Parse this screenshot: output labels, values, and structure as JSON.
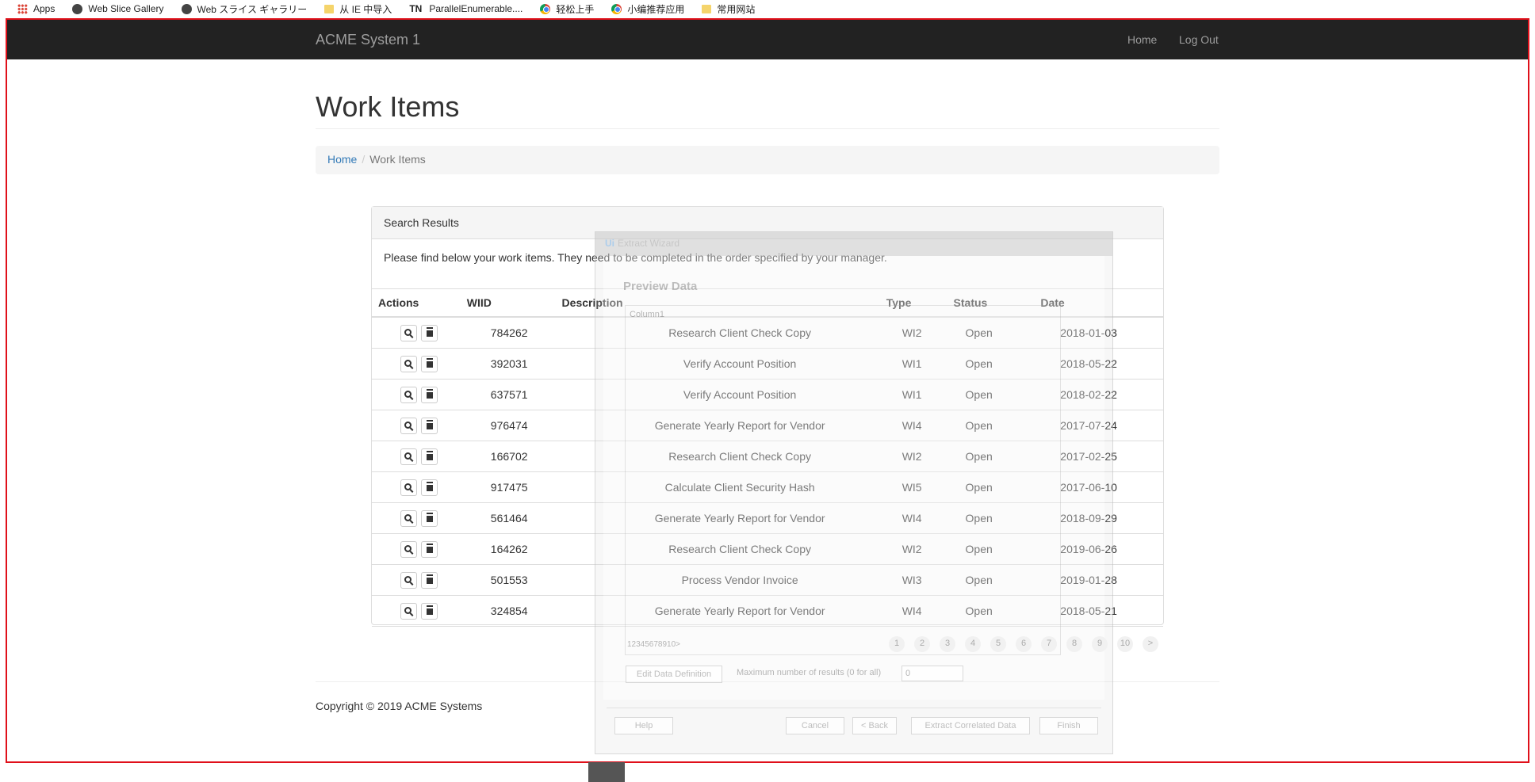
{
  "bookmarks": [
    {
      "label": "Apps",
      "icon": "apps-icon"
    },
    {
      "label": "Web Slice Gallery",
      "icon": "globe-icon"
    },
    {
      "label": "Web スライス ギャラリー",
      "icon": "globe-icon"
    },
    {
      "label": "从 IE 中导入",
      "icon": "folder-icon"
    },
    {
      "label": "ParallelEnumerable....",
      "icon": "tn-icon"
    },
    {
      "label": "轻松上手",
      "icon": "chrome-icon"
    },
    {
      "label": "小编推荐应用",
      "icon": "chrome-icon"
    },
    {
      "label": "常用网站",
      "icon": "folder-icon"
    }
  ],
  "navbar": {
    "brand": "ACME System 1",
    "home": "Home",
    "logout": "Log Out"
  },
  "page": {
    "title": "Work Items",
    "breadcrumb_home": "Home",
    "breadcrumb_current": "Work Items"
  },
  "panel": {
    "heading": "Search Results",
    "intro": "Please find below your work items. They need to be completed in the order specified by your manager.",
    "columns": [
      "Actions",
      "WIID",
      "Description",
      "Type",
      "Status",
      "Date"
    ],
    "rows": [
      {
        "wiid": "784262",
        "description": "Research Client Check Copy",
        "type": "WI2",
        "status": "Open",
        "date": "2018-01-03"
      },
      {
        "wiid": "392031",
        "description": "Verify Account Position",
        "type": "WI1",
        "status": "Open",
        "date": "2018-05-22"
      },
      {
        "wiid": "637571",
        "description": "Verify Account Position",
        "type": "WI1",
        "status": "Open",
        "date": "2018-02-22"
      },
      {
        "wiid": "976474",
        "description": "Generate Yearly Report for Vendor",
        "type": "WI4",
        "status": "Open",
        "date": "2017-07-24"
      },
      {
        "wiid": "166702",
        "description": "Research Client Check Copy",
        "type": "WI2",
        "status": "Open",
        "date": "2017-02-25"
      },
      {
        "wiid": "917475",
        "description": "Calculate Client Security Hash",
        "type": "WI5",
        "status": "Open",
        "date": "2017-06-10"
      },
      {
        "wiid": "561464",
        "description": "Generate Yearly Report for Vendor",
        "type": "WI4",
        "status": "Open",
        "date": "2018-09-29"
      },
      {
        "wiid": "164262",
        "description": "Research Client Check Copy",
        "type": "WI2",
        "status": "Open",
        "date": "2019-06-26"
      },
      {
        "wiid": "501553",
        "description": "Process Vendor Invoice",
        "type": "WI3",
        "status": "Open",
        "date": "2019-01-28"
      },
      {
        "wiid": "324854",
        "description": "Generate Yearly Report for Vendor",
        "type": "WI4",
        "status": "Open",
        "date": "2018-05-21"
      }
    ]
  },
  "footer": {
    "copyright": "Copyright © 2019 ACME Systems"
  },
  "wizard": {
    "logo": "Ui",
    "title": "Extract Wizard",
    "preview_title": "Preview Data",
    "column_header": "Column1",
    "pages_text": "12345678910>",
    "pages": [
      "1",
      "2",
      "3",
      "4",
      "5",
      "6",
      "7",
      "8",
      "9",
      "10",
      ">"
    ],
    "edit_button": "Edit Data Definition",
    "max_label": "Maximum number of results (0 for all)",
    "max_value": "0",
    "help": "Help",
    "cancel": "Cancel",
    "back": "< Back",
    "extract": "Extract Correlated Data",
    "finish": "Finish"
  }
}
